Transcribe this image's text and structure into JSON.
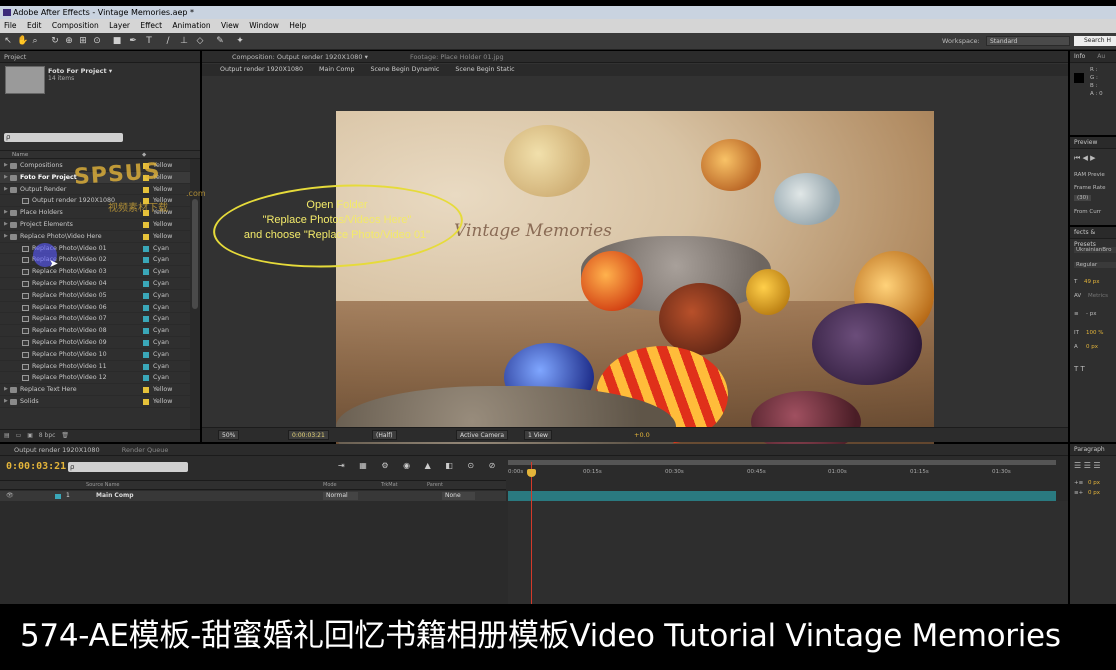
{
  "window": {
    "title": "Adobe After Effects - Vintage Memories.aep *"
  },
  "menu": [
    "File",
    "Edit",
    "Composition",
    "Layer",
    "Effect",
    "Animation",
    "View",
    "Window",
    "Help"
  ],
  "toolbar": {
    "workspace_label": "Workspace:",
    "workspace_value": "Standard",
    "search_placeholder": "Search H"
  },
  "project": {
    "tab": "Project",
    "selected_name": "Foto For Project ▾",
    "selected_count": "14 items",
    "search_value": "ρ",
    "col_name": "Name",
    "items": [
      {
        "name": "Compositions",
        "label": "Yellow",
        "color": "#e6c23a",
        "type": "folder",
        "indent": 0
      },
      {
        "name": "Foto For Project",
        "label": "Yellow",
        "color": "#e6c23a",
        "type": "folder",
        "indent": 0,
        "selected": true
      },
      {
        "name": "Output Render",
        "label": "Yellow",
        "color": "#e6c23a",
        "type": "folder",
        "indent": 0
      },
      {
        "name": "Output render 1920X1080",
        "label": "Yellow",
        "color": "#e6c23a",
        "type": "comp",
        "indent": 1
      },
      {
        "name": "Place Holders",
        "label": "Yellow",
        "color": "#e6c23a",
        "type": "folder",
        "indent": 0
      },
      {
        "name": "Project Elements",
        "label": "Yellow",
        "color": "#e6c23a",
        "type": "folder",
        "indent": 0
      },
      {
        "name": "Replace Photo\\Video Here",
        "label": "Yellow",
        "color": "#e6c23a",
        "type": "folder",
        "indent": 0
      },
      {
        "name": "Replace Photo\\Video 01",
        "label": "Cyan",
        "color": "#3aa7b8",
        "type": "comp",
        "indent": 1
      },
      {
        "name": "Replace Photo\\Video 02",
        "label": "Cyan",
        "color": "#3aa7b8",
        "type": "comp",
        "indent": 1
      },
      {
        "name": "Replace Photo\\Video 03",
        "label": "Cyan",
        "color": "#3aa7b8",
        "type": "comp",
        "indent": 1
      },
      {
        "name": "Replace Photo\\Video 04",
        "label": "Cyan",
        "color": "#3aa7b8",
        "type": "comp",
        "indent": 1
      },
      {
        "name": "Replace Photo\\Video 05",
        "label": "Cyan",
        "color": "#3aa7b8",
        "type": "comp",
        "indent": 1
      },
      {
        "name": "Replace Photo\\Video 06",
        "label": "Cyan",
        "color": "#3aa7b8",
        "type": "comp",
        "indent": 1
      },
      {
        "name": "Replace Photo\\Video 07",
        "label": "Cyan",
        "color": "#3aa7b8",
        "type": "comp",
        "indent": 1
      },
      {
        "name": "Replace Photo\\Video 08",
        "label": "Cyan",
        "color": "#3aa7b8",
        "type": "comp",
        "indent": 1
      },
      {
        "name": "Replace Photo\\Video 09",
        "label": "Cyan",
        "color": "#3aa7b8",
        "type": "comp",
        "indent": 1
      },
      {
        "name": "Replace Photo\\Video 10",
        "label": "Cyan",
        "color": "#3aa7b8",
        "type": "comp",
        "indent": 1
      },
      {
        "name": "Replace Photo\\Video 11",
        "label": "Cyan",
        "color": "#3aa7b8",
        "type": "comp",
        "indent": 1
      },
      {
        "name": "Replace Photo\\Video 12",
        "label": "Cyan",
        "color": "#3aa7b8",
        "type": "comp",
        "indent": 1
      },
      {
        "name": "Replace Text Here",
        "label": "Yellow",
        "color": "#e6c23a",
        "type": "folder",
        "indent": 0
      },
      {
        "name": "Solids",
        "label": "Yellow",
        "color": "#e6c23a",
        "type": "folder",
        "indent": 0
      }
    ],
    "bpc": "8 bpc"
  },
  "composition": {
    "tab": "Composition: Output render 1920X1080 ▾",
    "footage_tab": "Footage: Place Holder 01.jpg",
    "crumbs": [
      "Output render 1920X1080",
      "Main Comp",
      "Scene Begin Dynamic",
      "Scene Begin Static"
    ],
    "image_title": "Vintage Memories",
    "footer": {
      "zoom": "50%",
      "time": "0:00:03:21",
      "resolution": "(Half)",
      "camera": "Active Camera",
      "view": "1 View",
      "exposure": "+0.0"
    }
  },
  "annotation": {
    "lines": [
      "Open Folder",
      "\"Replace Photos/Videos Here\"",
      "and choose \"Replace Photo/Video 01\""
    ]
  },
  "watermark": {
    "text": "SPSUS",
    "sub": "视频素材下载",
    "domain": ".com"
  },
  "info_panel": {
    "tabs": [
      "Info",
      "Au"
    ],
    "channels": [
      "R :",
      "G :",
      "B :",
      "A : 0"
    ]
  },
  "preview_panel": {
    "tab": "Preview",
    "ram": "RAM Previe",
    "frame_rate_label": "Frame Rate",
    "frame_rate_value": "(30)",
    "from_current": "From Curr"
  },
  "char_panel": {
    "tab": "fects & Presets",
    "font": "UkrainianBro",
    "style": "Regular",
    "size": "49 px",
    "tracking": "Metrics",
    "stroke": "- px",
    "scale": "100 %",
    "baseline": "0 px"
  },
  "paragraph_panel": {
    "tab": "Paragraph",
    "indent_left": "0 px",
    "indent_right": "0 px"
  },
  "timeline": {
    "tabs": [
      "Output render 1920X1080",
      "Render Queue"
    ],
    "time": "0:00:03:21",
    "search": "ρ",
    "col_source": "Source Name",
    "col_mode": "Mode",
    "col_trkmat": "TrkMat",
    "col_parent": "Parent",
    "ruler": [
      "0:00s",
      "00:15s",
      "00:30s",
      "00:45s",
      "01:00s",
      "01:15s",
      "01:30s"
    ],
    "layer": {
      "index": "1",
      "name": "Main Comp",
      "mode": "Normal",
      "parent": "None"
    }
  },
  "caption": "574-AE模板-甜蜜婚礼回忆书籍相册模板Video Tutorial Vintage Memories"
}
